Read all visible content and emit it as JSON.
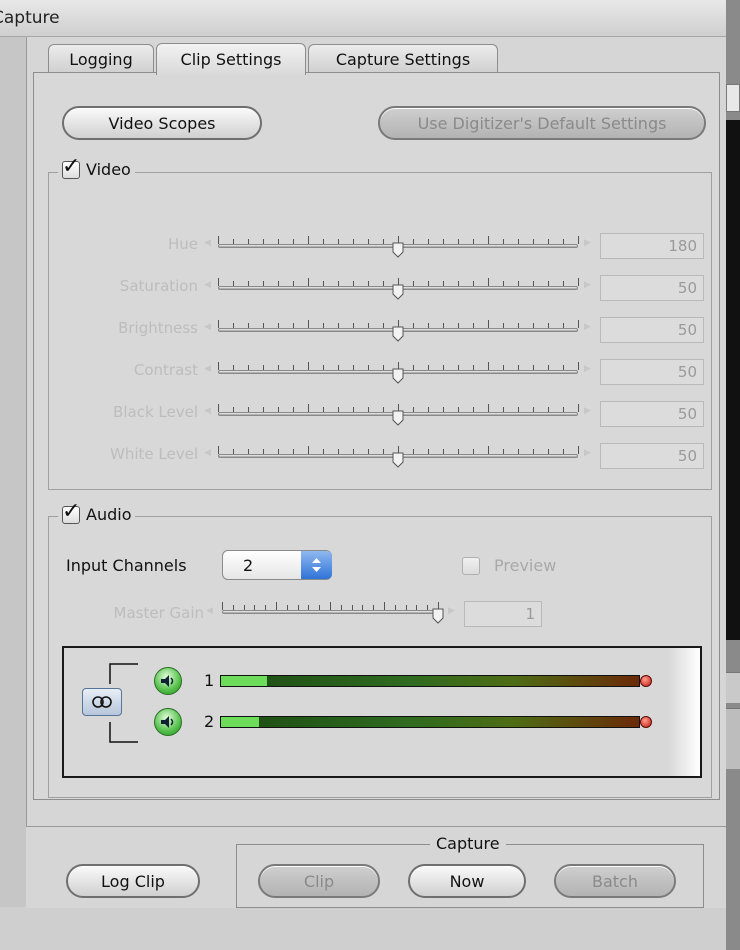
{
  "window": {
    "title": "Capture"
  },
  "tabs": [
    {
      "label": "Logging",
      "active": false
    },
    {
      "label": "Clip Settings",
      "active": true
    },
    {
      "label": "Capture Settings",
      "active": false
    }
  ],
  "buttons": {
    "video_scopes": "Video Scopes",
    "use_default": "Use Digitizer's Default Settings"
  },
  "video": {
    "label": "Video",
    "checked": true,
    "sliders": [
      {
        "label": "Hue",
        "value": "180",
        "position_fraction": 0.5
      },
      {
        "label": "Saturation",
        "value": "50",
        "position_fraction": 0.5
      },
      {
        "label": "Brightness",
        "value": "50",
        "position_fraction": 0.5
      },
      {
        "label": "Contrast",
        "value": "50",
        "position_fraction": 0.5
      },
      {
        "label": "Black Level",
        "value": "50",
        "position_fraction": 0.5
      },
      {
        "label": "White Level",
        "value": "50",
        "position_fraction": 0.5
      }
    ]
  },
  "audio": {
    "label": "Audio",
    "checked": true,
    "input_channels_label": "Input Channels",
    "input_channels_value": "2",
    "preview_label": "Preview",
    "preview_checked": false,
    "master_gain_label": "Master Gain",
    "master_gain_value": "1",
    "master_gain_fraction": 1.0,
    "channels": [
      {
        "number": "1",
        "level_fraction": 0.11
      },
      {
        "number": "2",
        "level_fraction": 0.09
      }
    ]
  },
  "footer": {
    "log_clip": "Log Clip",
    "capture_group_label": "Capture",
    "clip": "Clip",
    "now": "Now",
    "batch": "Batch"
  },
  "colors": {
    "accent_blue": "#2f73d8",
    "meter_green": "#6ddc5a",
    "peak_red": "#c01a10"
  }
}
